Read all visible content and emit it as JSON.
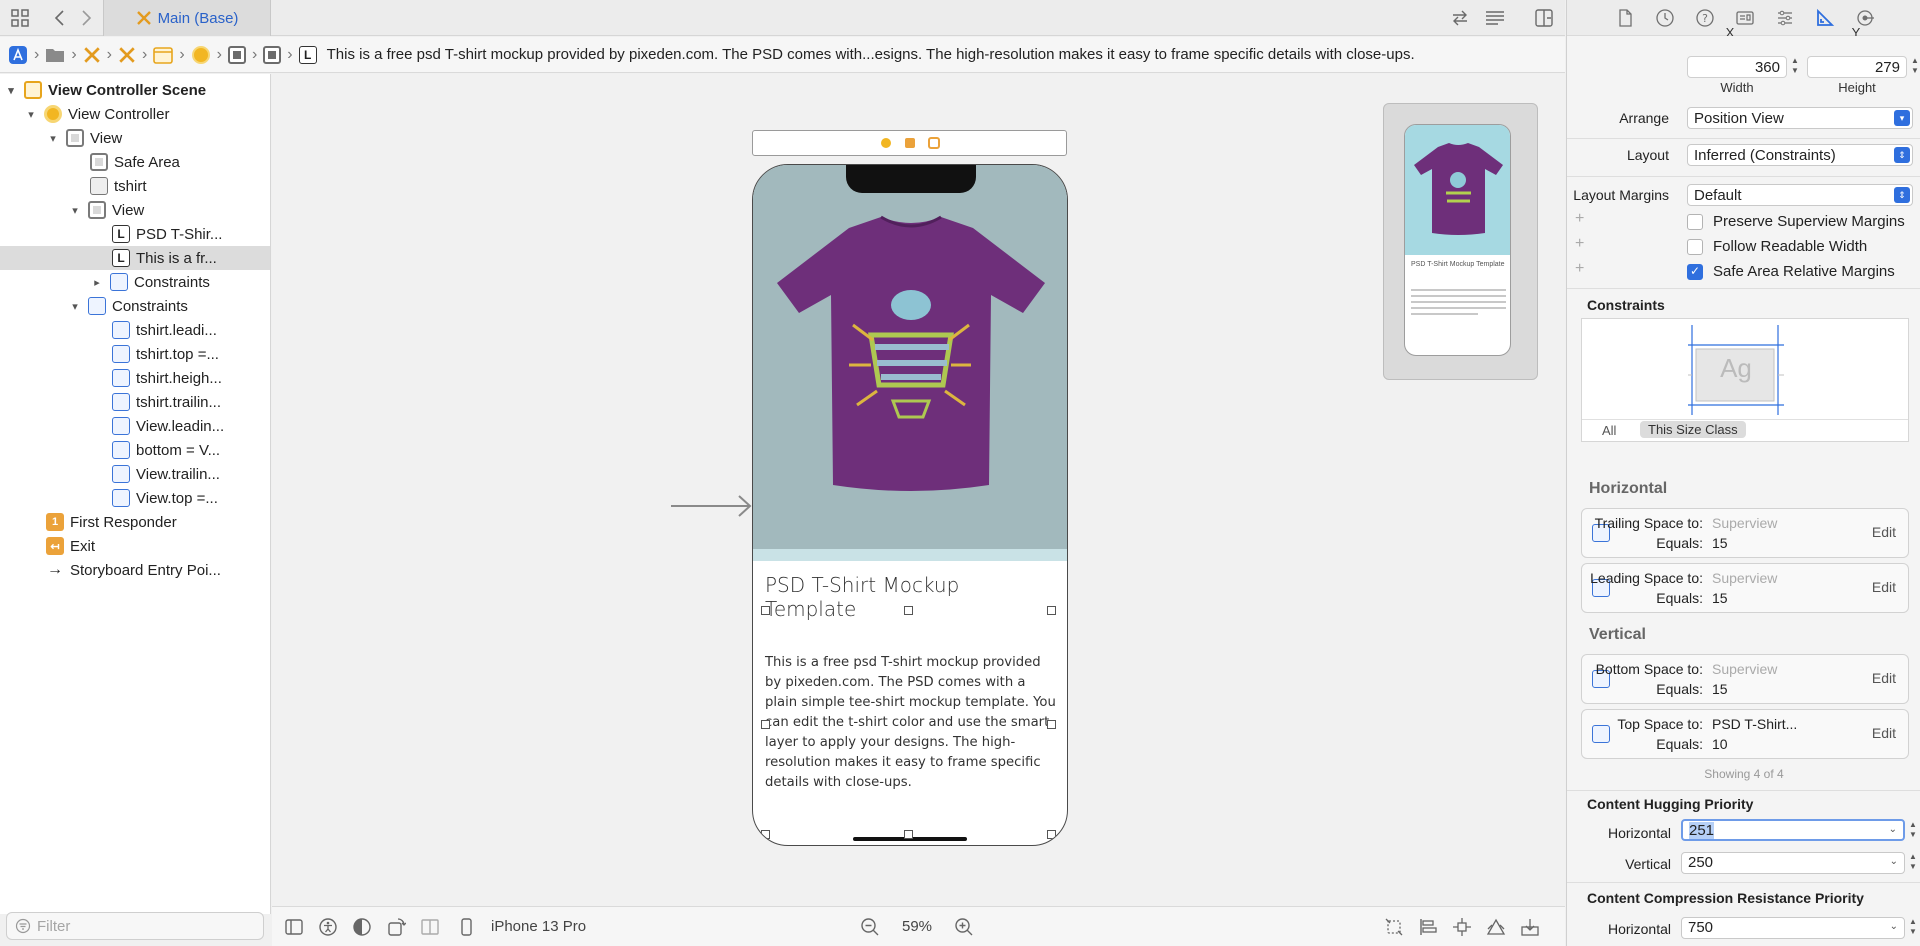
{
  "window": {
    "tab_title": "Main (Base)"
  },
  "jumpbar": {
    "final_label": "This is a free psd T-shirt mockup provided by pixeden.com. The PSD comes with...esigns. The high-resolution makes it easy to frame specific details with close-ups."
  },
  "outline": {
    "rows": [
      {
        "label": "View Controller Scene"
      },
      {
        "label": "View Controller"
      },
      {
        "label": "View"
      },
      {
        "label": "Safe Area"
      },
      {
        "label": "tshirt"
      },
      {
        "label": "View"
      },
      {
        "label": "PSD T-Shir..."
      },
      {
        "label": "This is a fr..."
      },
      {
        "label": "Constraints"
      },
      {
        "label": "Constraints"
      },
      {
        "label": "tshirt.leadi..."
      },
      {
        "label": "tshirt.top =..."
      },
      {
        "label": "tshirt.heigh..."
      },
      {
        "label": "tshirt.trailin..."
      },
      {
        "label": "View.leadin..."
      },
      {
        "label": "bottom = V..."
      },
      {
        "label": "View.trailin..."
      },
      {
        "label": "View.top =..."
      },
      {
        "label": "First Responder"
      },
      {
        "label": "Exit"
      },
      {
        "label": "Storyboard Entry Poi..."
      }
    ],
    "filter_placeholder": "Filter"
  },
  "canvas": {
    "title_text": "PSD T-Shirt Mockup Template",
    "description_text": "This is a free psd T-shirt mockup provided by pixeden.com. The PSD comes with a plain simple tee-shirt mockup template. You can edit the t-shirt color and use the smart layer to apply your designs. The high-resolution makes it easy to frame specific details with close-ups.",
    "shirt_color": "#6e2f7a",
    "hero_color": "#a2b9bd"
  },
  "minimap": {
    "title": "PSD T-Shirt Mockup Template"
  },
  "bottom_bar": {
    "device": "iPhone 13 Pro",
    "zoom": "59%"
  },
  "inspector": {
    "x_value": "360",
    "y_value": "279",
    "width_label": "Width",
    "height_label": "Height",
    "x_caption": "X",
    "y_caption": "Y",
    "arrange_label": "Arrange",
    "arrange_value": "Position View",
    "layout_label": "Layout",
    "layout_value": "Inferred (Constraints)",
    "margins_label": "Layout Margins",
    "margins_value": "Default",
    "preserve_label": "Preserve Superview Margins",
    "readable_label": "Follow Readable Width",
    "safe_area_label": "Safe Area Relative Margins",
    "preserve_checked": false,
    "readable_checked": false,
    "safe_area_checked": true,
    "constraints_title": "Constraints",
    "preview_text": "Ag",
    "seg_all": "All",
    "seg_size_class": "This Size Class",
    "horizontal_title": "Horizontal",
    "vertical_title": "Vertical",
    "cards": [
      {
        "key": "Trailing Space to:",
        "target": "Superview",
        "equals_label": "Equals:",
        "equals": "15",
        "edit": "Edit"
      },
      {
        "key": "Leading Space to:",
        "target": "Superview",
        "equals_label": "Equals:",
        "equals": "15",
        "edit": "Edit"
      },
      {
        "key": "Bottom Space to:",
        "target": "Superview",
        "equals_label": "Equals:",
        "equals": "15",
        "edit": "Edit"
      },
      {
        "key": "Top Space to:",
        "target": "PSD T-Shirt...",
        "equals_label": "Equals:",
        "equals": "10",
        "edit": "Edit"
      }
    ],
    "showing": "Showing 4 of 4",
    "hugging_title": "Content Hugging Priority",
    "hugging_h_label": "Horizontal",
    "hugging_h_value": "251",
    "hugging_v_label": "Vertical",
    "hugging_v_value": "250",
    "compression_title": "Content Compression Resistance Priority",
    "compression_h_label": "Horizontal",
    "compression_h_value": "750",
    "accent_color": "#2f6fde"
  }
}
